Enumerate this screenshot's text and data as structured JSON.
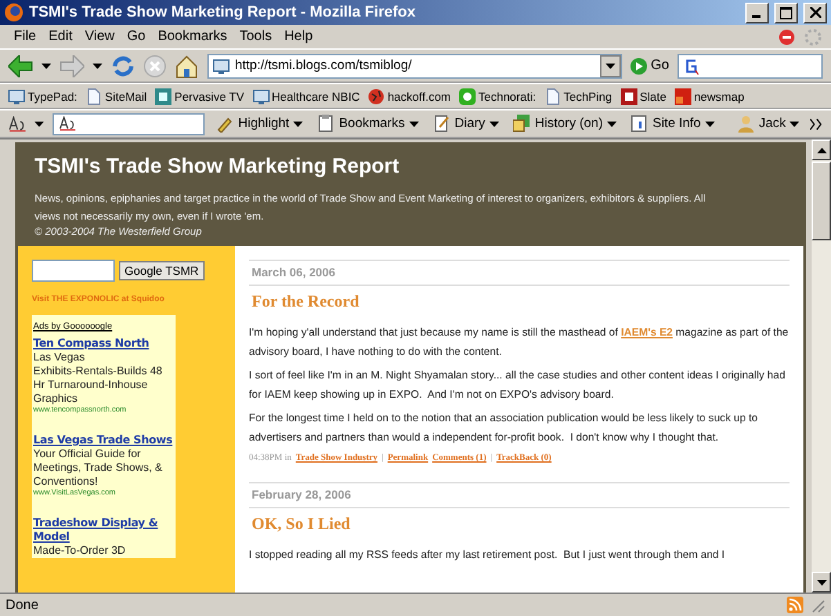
{
  "window": {
    "title": "TSMI's Trade Show Marketing Report - Mozilla Firefox"
  },
  "menu": [
    "File",
    "Edit",
    "View",
    "Go",
    "Bookmarks",
    "Tools",
    "Help"
  ],
  "address": {
    "value": "http://tsmi.blogs.com/tsmiblog/"
  },
  "go_label": "Go",
  "bookmarks": [
    {
      "label": "TypePad:",
      "kind": "screen"
    },
    {
      "label": "SiteMail",
      "kind": "page"
    },
    {
      "label": "Pervasive TV",
      "kind": "tv"
    },
    {
      "label": "Healthcare NBIC",
      "kind": "screen"
    },
    {
      "label": "hackoff.com",
      "kind": "globe"
    },
    {
      "label": "Technorati:",
      "kind": "chat"
    },
    {
      "label": "TechPing",
      "kind": "page"
    },
    {
      "label": "Slate",
      "kind": "slate"
    },
    {
      "label": "newsmap",
      "kind": "map"
    }
  ],
  "toolbar": [
    {
      "label": "Highlight",
      "kind": "pen"
    },
    {
      "label": "Bookmarks",
      "kind": "book"
    },
    {
      "label": "Diary",
      "kind": "note"
    },
    {
      "label": "History (on)",
      "kind": "history"
    },
    {
      "label": "Site Info",
      "kind": "info"
    }
  ],
  "user": "Jack",
  "blog": {
    "title": "TSMI's Trade Show Marketing Report",
    "tagline": "News, opinions, epiphanies and target practice in the world of Trade Show and Event Marketing of interest to organizers, exhibitors & suppliers. All views not necessarily my own, even if I wrote 'em.",
    "copyright": "© 2003-2004 The Westerfield Group"
  },
  "sidebar": {
    "search_button": "Google TSMR",
    "promo": "Visit THE EXPONOLIC at Squidoo",
    "ads_label": "Ads by Goooooogle",
    "ads": [
      {
        "title": "Ten Compass North",
        "lines": [
          "Las Vegas",
          "Exhibits-Rentals-Builds 48",
          "Hr Turnaround-Inhouse",
          "Graphics"
        ],
        "url": "www.tencompassnorth.com"
      },
      {
        "title": "Las Vegas Trade Shows",
        "lines": [
          "Your Official Guide for",
          "Meetings, Trade Shows, &",
          "Conventions!"
        ],
        "url": "www.VisitLasVegas.com"
      },
      {
        "title": "Tradeshow Display & Model",
        "lines": [
          "Made-To-Order 3D"
        ]
      }
    ]
  },
  "posts": [
    {
      "date": "March 06, 2006",
      "title": "For the Record",
      "paragraphs": [
        [
          {
            "text": "I'm hoping y'all understand that just because my name is still the masthead of ",
            "kind": "plain"
          },
          {
            "text": "IAEM's E2",
            "kind": "link"
          },
          {
            "text": " magazine as part of the advisory board, I have nothing to do with the content.",
            "kind": "plain"
          }
        ],
        [
          {
            "text": "I sort of feel like I'm in an M. Night Shyamalan story... all the case studies and other content ideas I originally had for IAEM keep showing up in EXPO.  And I'm not on EXPO's advisory board.",
            "kind": "plain"
          }
        ],
        [
          {
            "text": "For the longest time I held on to the notion that an association publication would be less likely to suck up to advertisers and partners than would a independent for-profit book.  I don't know why I thought that.",
            "kind": "plain"
          }
        ]
      ],
      "meta": [
        {
          "text": "04:38PM in",
          "kind": "plain"
        },
        {
          "text": "Trade Show Industry",
          "kind": "link"
        },
        {
          "text": "|",
          "kind": "plain"
        },
        {
          "text": "Permalink",
          "kind": "link"
        },
        {
          "text": "Comments (1)",
          "kind": "link"
        },
        {
          "text": "|",
          "kind": "plain"
        },
        {
          "text": "TrackBack (0)",
          "kind": "link"
        }
      ]
    },
    {
      "date": "February 28, 2006",
      "title": "OK, So I Lied",
      "paragraphs": [
        [
          {
            "text": "I stopped reading all my RSS feeds after my last retirement post.  But I just went through them and I",
            "kind": "plain"
          }
        ]
      ]
    }
  ],
  "status": "Done"
}
